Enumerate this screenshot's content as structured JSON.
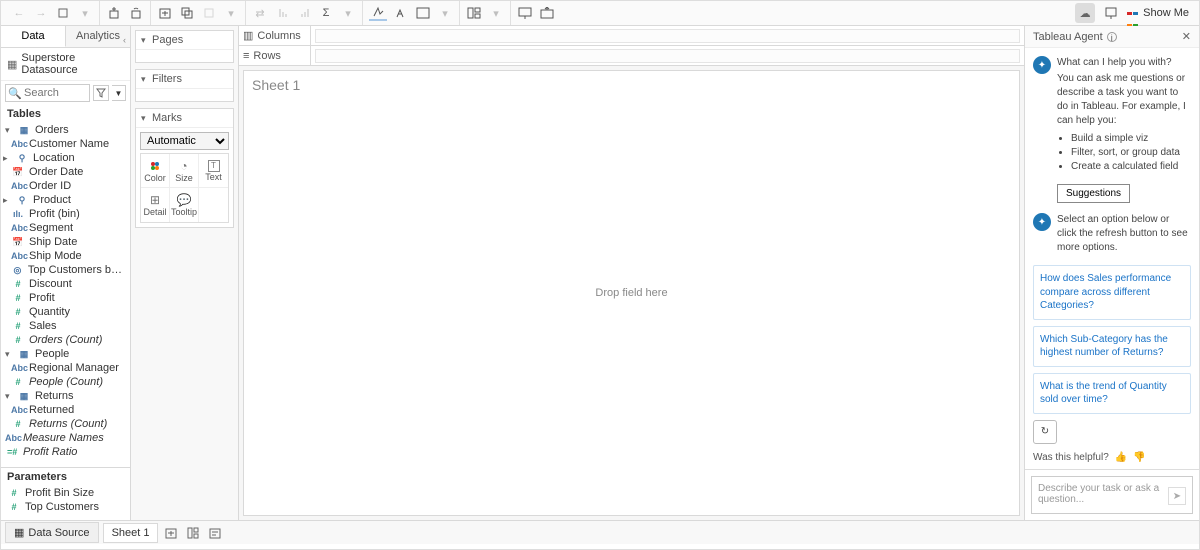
{
  "toolbar": {
    "showme": "Show Me"
  },
  "left_panel": {
    "tabs": {
      "data": "Data",
      "analytics": "Analytics"
    },
    "datasource": "Superstore Datasource",
    "search_placeholder": "Search",
    "tables_heading": "Tables",
    "groups": {
      "orders": "Orders",
      "people": "People",
      "returns": "Returns"
    },
    "fields": {
      "customer_name": "Customer Name",
      "location": "Location",
      "order_date": "Order Date",
      "order_id": "Order ID",
      "product": "Product",
      "profit_bin": "Profit (bin)",
      "segment": "Segment",
      "ship_date": "Ship Date",
      "ship_mode": "Ship Mode",
      "top_customers": "Top Customers by P...",
      "discount": "Discount",
      "profit": "Profit",
      "quantity": "Quantity",
      "sales": "Sales",
      "orders_count": "Orders (Count)",
      "regional_manager": "Regional Manager",
      "people_count": "People (Count)",
      "returned": "Returned",
      "returns_count": "Returns (Count)",
      "measure_names": "Measure Names",
      "profit_ratio": "Profit Ratio"
    },
    "parameters_heading": "Parameters",
    "params": {
      "profit_bin_size": "Profit Bin Size",
      "top_customers_p": "Top Customers"
    }
  },
  "cards": {
    "pages": "Pages",
    "filters": "Filters",
    "marks": "Marks",
    "marks_select": "Automatic",
    "cells": {
      "color": "Color",
      "size": "Size",
      "text": "Text",
      "detail": "Detail",
      "tooltip": "Tooltip"
    }
  },
  "shelves": {
    "columns": "Columns",
    "rows": "Rows"
  },
  "canvas": {
    "title": "Sheet 1",
    "hint": "Drop field here"
  },
  "agent": {
    "title": "Tableau Agent",
    "intro_q": "What can I help you with?",
    "intro_body": "You can ask me questions or describe a task you want to do in Tableau. For example, I can help you:",
    "bullets": [
      "Build a simple viz",
      "Filter, sort, or group data",
      "Create a calculated field"
    ],
    "suggestions_btn": "Suggestions",
    "select_prompt": "Select an option below or click the refresh button to see more options.",
    "sugg1": "How does Sales performance compare across different Categories?",
    "sugg2": "Which Sub-Category has the highest number of Returns?",
    "sugg3": "What is the trend of Quantity sold over time?",
    "helpful": "Was this helpful?",
    "placeholder": "Describe your task or ask a question..."
  },
  "footer": {
    "data_source": "Data Source",
    "sheet1": "Sheet 1"
  }
}
